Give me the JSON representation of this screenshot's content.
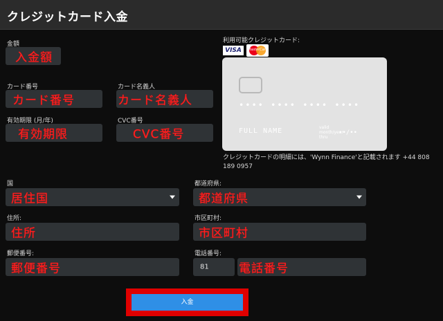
{
  "header": {
    "title": "クレジットカード入金"
  },
  "amount": {
    "label": "金額",
    "overlay": "入金額"
  },
  "card_number": {
    "label": "カード番号",
    "overlay": "カード番号"
  },
  "card_holder": {
    "label": "カード名義人",
    "overlay": "カード名義人"
  },
  "expiry": {
    "label": "有効期限 (月/年)",
    "overlay": "有効期限"
  },
  "cvc": {
    "label": "CVC番号",
    "overlay": "CVC番号"
  },
  "accepted": {
    "label": "利用可能クレジットカード:",
    "brands": [
      "VISA",
      "MasterCard"
    ]
  },
  "card_preview": {
    "number": "•••• •••• •••• ••••",
    "name": "FULL NAME",
    "expiry_caption": "valid month/year thru",
    "expiry_value": "••/••"
  },
  "statement_note": "クレジットカードの明細には、'Wynn Finance'と記載されます +44 808 189 0957",
  "country": {
    "label": "国",
    "overlay": "居住国"
  },
  "prefecture": {
    "label": "都道府県:",
    "overlay": "都道府県"
  },
  "address": {
    "label": "住所:",
    "overlay": "住所"
  },
  "city": {
    "label": "市区町村:",
    "overlay": "市区町村"
  },
  "postal": {
    "label": "郵便番号:",
    "overlay": "郵便番号"
  },
  "phone": {
    "label": "電話番号:",
    "country_code": "81",
    "overlay": "電話番号"
  },
  "submit": {
    "label": "入金"
  },
  "colors": {
    "overlay_text": "#ff2020",
    "button": "#2f8fe6",
    "highlight_border": "#e00000"
  }
}
